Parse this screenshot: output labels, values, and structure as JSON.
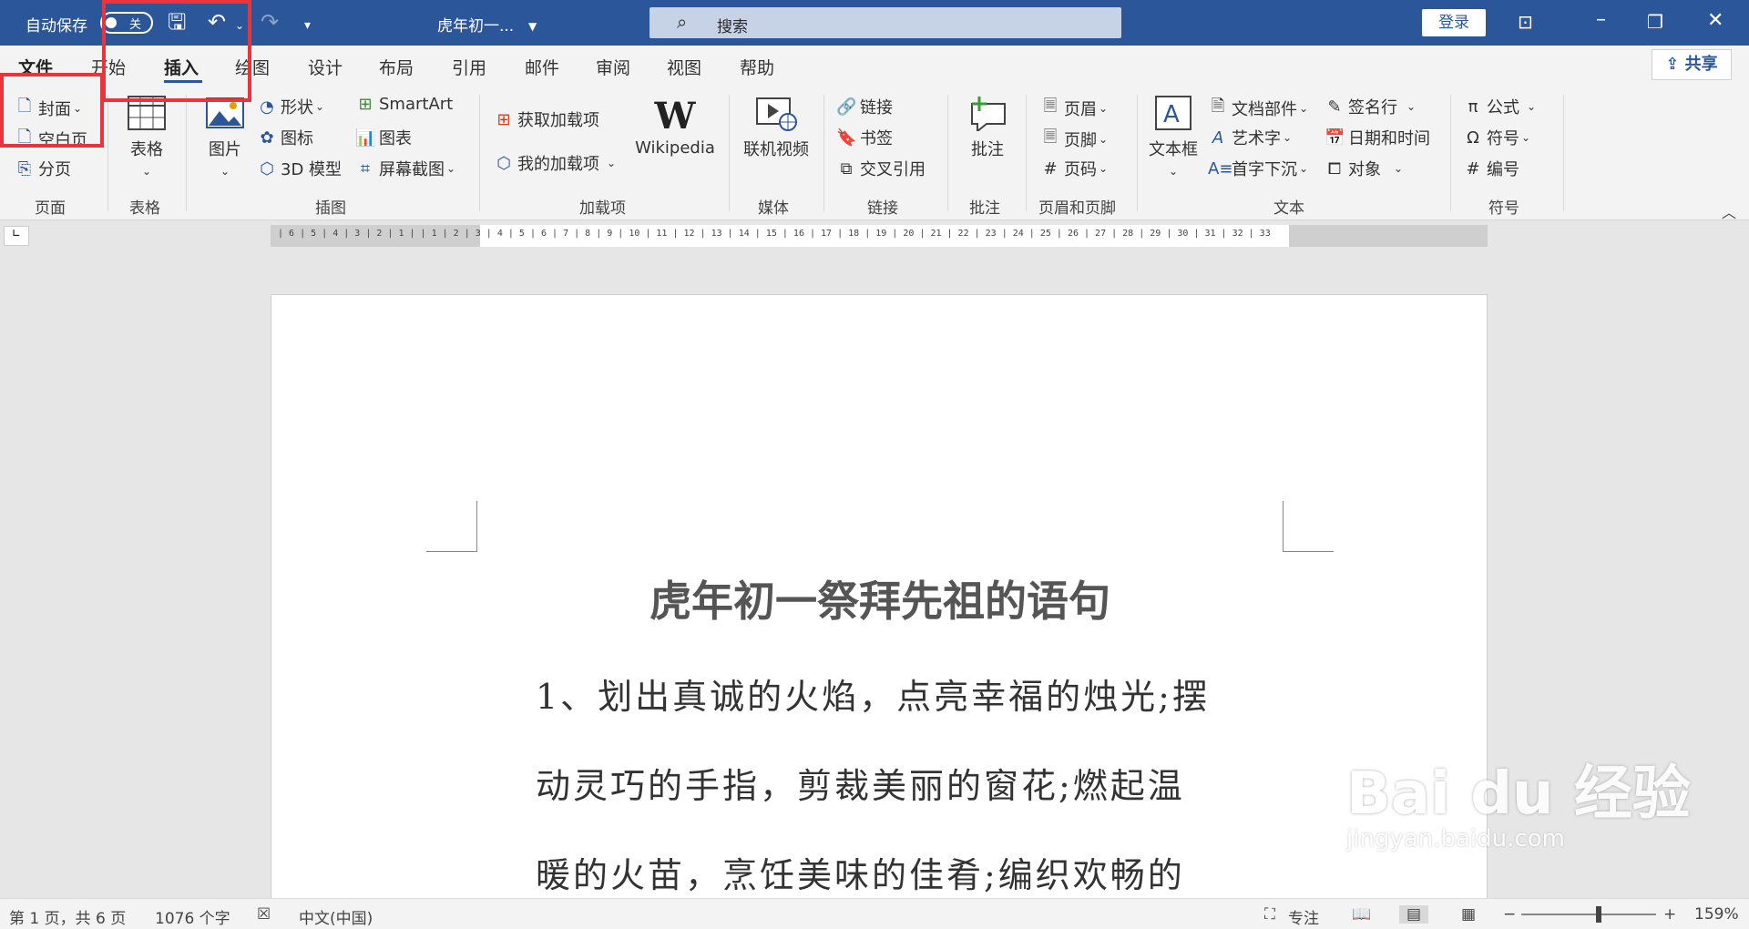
{
  "titlebar": {
    "autosave_label": "自动保存",
    "autosave_state": "关",
    "doc_title": "虎年初一...",
    "search_placeholder": "搜索",
    "login": "登录"
  },
  "tabs": [
    {
      "label": "文件"
    },
    {
      "label": "开始"
    },
    {
      "label": "插入"
    },
    {
      "label": "绘图"
    },
    {
      "label": "设计"
    },
    {
      "label": "布局"
    },
    {
      "label": "引用"
    },
    {
      "label": "邮件"
    },
    {
      "label": "审阅"
    },
    {
      "label": "视图"
    },
    {
      "label": "帮助"
    }
  ],
  "share_label": "共享",
  "ribbon": {
    "page": {
      "cover": "封面",
      "blank": "空白页",
      "break": "分页",
      "group": "页面"
    },
    "table": {
      "table": "表格",
      "group": "表格"
    },
    "illustrations": {
      "picture": "图片",
      "shapes": "形状",
      "icons": "图标",
      "model3d": "3D 模型",
      "smartart": "SmartArt",
      "chart": "图表",
      "screenshot": "屏幕截图",
      "group": "插图"
    },
    "addins": {
      "get": "获取加载项",
      "mine": "我的加载项",
      "wikipedia": "Wikipedia",
      "group": "加载项"
    },
    "media": {
      "video": "联机视频",
      "group": "媒体"
    },
    "links": {
      "link": "链接",
      "bookmark": "书签",
      "crossref": "交叉引用",
      "group": "链接"
    },
    "comments": {
      "comment": "批注",
      "group": "批注"
    },
    "headerfooter": {
      "header": "页眉",
      "footer": "页脚",
      "pagenum": "页码",
      "group": "页眉和页脚"
    },
    "text": {
      "textbox": "文本框",
      "quickparts": "文档部件",
      "wordart": "艺术字",
      "dropcap": "首字下沉",
      "signature": "签名行",
      "datetime": "日期和时间",
      "object": "对象",
      "group": "文本"
    },
    "symbols": {
      "equation": "公式",
      "symbol": "符号",
      "number": "编号",
      "group": "符号"
    }
  },
  "ruler_text": "| 6 | 5 | 4 | 3 | 2 | 1 |     | 1 | 2 | 3 | 4 | 5 | 6 | 7 | 8 | 9 | 10 | 11 | 12 | 13 | 14 | 15 | 16 | 17 | 18 | 19 | 20 | 21 | 22 | 23 | 24 | 25 | 26 | 27 | 28 | 29 | 30 | 31 | 32 | 33",
  "document": {
    "title": "虎年初一祭拜先祖的语句",
    "lines": [
      "1、划出真诚的火焰，点亮幸福的烛光;摆",
      "动灵巧的手指，剪裁美丽的窗花;燃起温",
      "暖的火苗，烹饪美味的佳肴;编织欢畅的"
    ]
  },
  "watermark": {
    "main": "Bai du 经验",
    "sub": "jingyan.baidu.com"
  },
  "status": {
    "page": "第 1 页，共 6 页",
    "words": "1076 个字",
    "language": "中文(中国)",
    "focus": "专注",
    "zoom": "159%"
  },
  "colors": {
    "accent": "#2b579a",
    "highlight": "#e8343a"
  }
}
